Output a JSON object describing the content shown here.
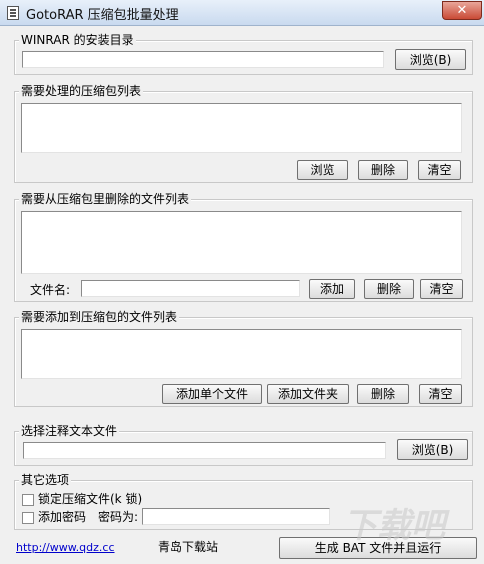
{
  "window": {
    "title": "GotoRAR 压缩包批量处理",
    "close_label": "✕"
  },
  "winrar_group": {
    "legend": "WINRAR 的安装目录",
    "path_value": "",
    "browse_label": "浏览(B)"
  },
  "archive_group": {
    "legend": "需要处理的压缩包列表",
    "browse_label": "浏览",
    "delete_label": "删除",
    "clear_label": "清空"
  },
  "remove_group": {
    "legend": "需要从压缩包里删除的文件列表",
    "filename_label": "文件名:",
    "filename_value": "",
    "add_label": "添加",
    "delete_label": "删除",
    "clear_label": "清空"
  },
  "add_group": {
    "legend": "需要添加到压缩包的文件列表",
    "add_file_label": "添加单个文件",
    "add_folder_label": "添加文件夹",
    "delete_label": "删除",
    "clear_label": "清空"
  },
  "comment_group": {
    "legend": "选择注释文本文件",
    "path_value": "",
    "browse_label": "浏览(B)"
  },
  "options_group": {
    "legend": "其它选项",
    "lock_label": "锁定压缩文件(k 锁)",
    "password_check_label": "添加密码",
    "password_label": "密码为:",
    "password_value": ""
  },
  "footer": {
    "link": "http://www.qdz.cc",
    "site_name": "青岛下载站",
    "run_label": "生成 BAT 文件并且运行"
  },
  "watermark": "下载吧"
}
